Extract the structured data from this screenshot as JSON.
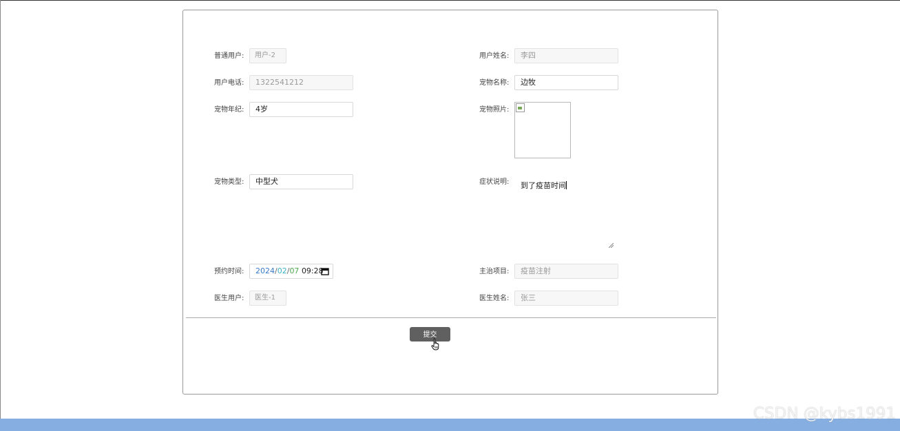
{
  "form": {
    "user_label": "普通用户:",
    "user_value": "用户-2",
    "user_name_label": "用户姓名:",
    "user_name_value": "李四",
    "phone_label": "用户电话:",
    "phone_value": "1322541212",
    "pet_name_label": "宠物名称:",
    "pet_name_value": "边牧",
    "pet_age_label": "宠物年纪:",
    "pet_age_value": "4岁",
    "pet_photo_label": "宠物照片:",
    "pet_type_label": "宠物类型:",
    "pet_type_value": "中型犬",
    "symptom_label": "症状说明:",
    "symptom_value": "到了疫苗时间",
    "appt_label": "预约时间:",
    "appt_year": "2024",
    "appt_month": "02",
    "appt_day": "07",
    "appt_time": "09:28",
    "project_label": "主治项目:",
    "project_value": "疫苗注射",
    "doctor_user_label": "医生用户:",
    "doctor_user_value": "医生-1",
    "doctor_name_label": "医生姓名:",
    "doctor_name_value": "张三",
    "submit_label": "提交"
  },
  "watermark": "CSDN @kybs1991",
  "icons": [
    "broken-image-icon",
    "calendar-icon",
    "resize-handle-icon",
    "hand-pointer-icon"
  ],
  "colors": {
    "submit_bg": "#606060",
    "footer_bar": "#86aee0",
    "date_year": "#3a7ac9",
    "date_month": "#3bb0c8",
    "date_day": "#4aa84a"
  }
}
